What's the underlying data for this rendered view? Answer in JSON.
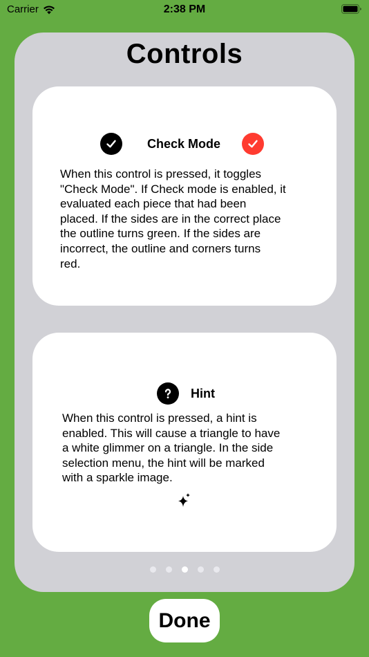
{
  "status_bar": {
    "carrier": "Carrier",
    "time": "2:38 PM"
  },
  "page": {
    "title": "Controls"
  },
  "cards": [
    {
      "title": "Check Mode",
      "icons": [
        "checkmark-circle-black-icon",
        "checkmark-circle-red-icon"
      ],
      "text": "When this control is  pressed, it toggles\n\"Check Mode\". If Check mode is enabled, it\nevaluated each piece that had been\nplaced. If the sides are in the correct place\nthe outline turns green. If the sides are\nincorrect, the outline and corners turns\nred."
    },
    {
      "title": "Hint",
      "icons": [
        "question-mark-circle-icon",
        "sparkle-icon"
      ],
      "text": "When this control is  pressed, a hint is\nenabled.  This will cause a triangle to have\na white glimmer on a triangle. In the side\nselection menu, the hint will be marked\nwith a sparkle image."
    }
  ],
  "pager": {
    "count": 5,
    "current_index": 2
  },
  "done_button": {
    "label": "Done"
  },
  "colors": {
    "background": "#64ac42",
    "panel": "#d1d1d6",
    "card": "#ffffff",
    "check_red": "#ff3b30"
  }
}
